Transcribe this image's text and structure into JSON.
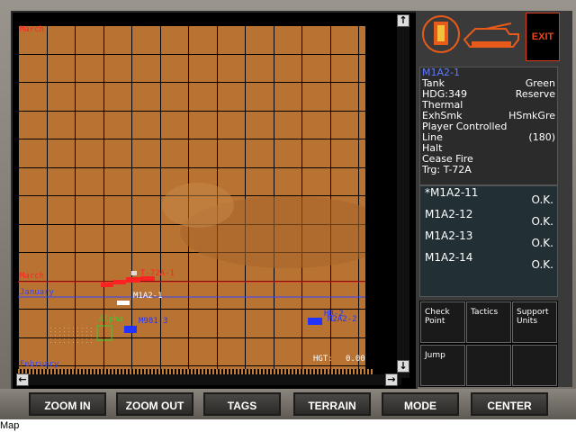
{
  "exit_label": "EXIT",
  "map": {
    "month_labels": [
      {
        "text": "March",
        "color": "#ff2222"
      },
      {
        "text": "March",
        "color": "#ff2222"
      },
      {
        "text": "January",
        "color": "#3344ff"
      },
      {
        "text": "February",
        "color": "#3344ff"
      }
    ],
    "unit_labels": [
      {
        "text": "T-72A-1",
        "color": "#ff2222"
      },
      {
        "text": "M1A2-1",
        "color": "#ffffff"
      },
      {
        "text": "M981-3",
        "color": "#2233ff"
      },
      {
        "text": "Alpha",
        "color": "#33cc33"
      },
      {
        "text": "M2A2-2",
        "color": "#2233ff"
      },
      {
        "text": "HB-2",
        "color": "#2233ff"
      }
    ],
    "hgt_label": "HGT:",
    "hgt_value": "0.00"
  },
  "unit_info": {
    "title": "M1A2-1",
    "rows": [
      [
        "Tank",
        "Green"
      ],
      [
        "HDG:349",
        "Reserve"
      ],
      [
        "Thermal",
        ""
      ],
      [
        "ExhSmk",
        "HSmkGre"
      ],
      [
        "Player Controlled",
        ""
      ],
      [
        "Line",
        "(180)"
      ],
      [
        "Halt",
        ""
      ],
      [
        "Cease Fire",
        ""
      ],
      [
        "Trg: T-72A",
        ""
      ]
    ]
  },
  "units": [
    {
      "name": "*M1A2-11",
      "status": "O.K."
    },
    {
      "name": "M1A2-12",
      "status": "O.K."
    },
    {
      "name": "M1A2-13",
      "status": "O.K."
    },
    {
      "name": "M1A2-14",
      "status": "O.K."
    }
  ],
  "commands": [
    "Check Point",
    "Tactics",
    "Support Units",
    "Jump",
    "",
    ""
  ],
  "buttons": [
    "ZOOM IN",
    "ZOOM OUT",
    "TAGS",
    "TERRAIN",
    "MODE",
    "CENTER"
  ],
  "status_text": "Map",
  "colors": {
    "terrain": "#b87333",
    "grid": "#000000",
    "red_force": "#ff2222",
    "blue_force": "#2233ff"
  },
  "icons": [
    "arrow-up-icon",
    "arrow-down-icon",
    "arrow-left-icon",
    "arrow-right-icon",
    "tank-icon",
    "apc-icon",
    "waypoint-icon",
    "logo-icon"
  ]
}
